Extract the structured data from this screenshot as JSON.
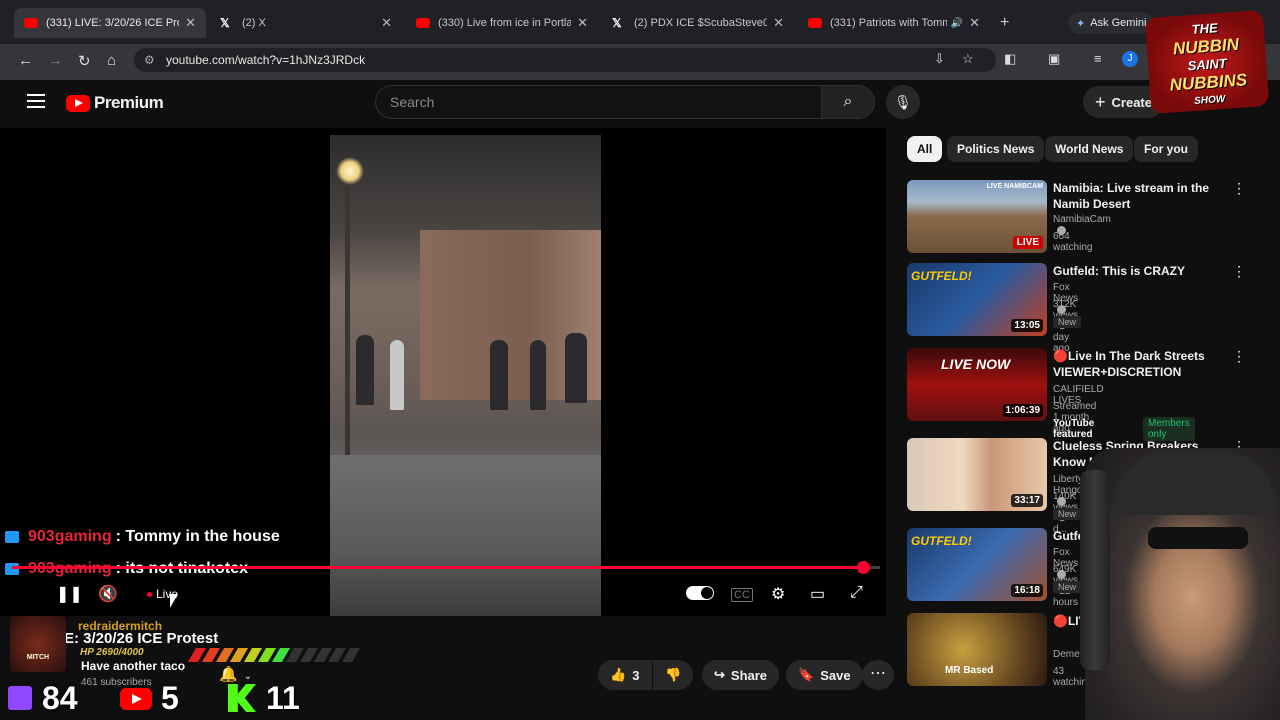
{
  "browser": {
    "tabs": [
      {
        "label": "(331) LIVE: 3/20/26 ICE Protest",
        "icon": "youtube-icon",
        "active": true
      },
      {
        "label": "(2) X",
        "icon": "x-icon",
        "active": false
      },
      {
        "label": "(330) Live from ice in Portland",
        "icon": "youtube-icon",
        "active": false
      },
      {
        "label": "(2) PDX ICE $ScubaSteve02626",
        "icon": "x-icon",
        "active": false
      },
      {
        "label": "(331) Patriots with Tommy",
        "icon": "youtube-icon",
        "active": false
      }
    ],
    "new_tab": "+",
    "gemini": "Ask Gemini",
    "url": "youtube.com/watch?v=1hJNz3JRDck",
    "profile_initial": "J"
  },
  "youtube": {
    "logo_text": "Premium",
    "search_placeholder": "Search",
    "create_label": "Create"
  },
  "player": {
    "live_label": "Live",
    "progress_fraction": 0.98
  },
  "chat_overlay": [
    {
      "user": "903gaming",
      "message": ": Tommy in the house"
    },
    {
      "user": "903gaming",
      "message": ": its not tinakotex"
    }
  ],
  "video_info": {
    "title_partial": "E: 3/20/26 ICE Protest",
    "subscribers": "461 subscribers",
    "like_count": "3",
    "share_label": "Share",
    "save_label": "Save"
  },
  "stream_overlay": {
    "username": "redraidermitch",
    "avatar_text": "MITCH",
    "hp": "HP 2690/4000",
    "message": "Have another taco",
    "twitch_count": "84",
    "youtube_count": "5",
    "kick_count": "11",
    "show_logo": [
      "THE",
      "NUBBIN",
      "SAINT",
      "NUBBINS",
      "SHOW"
    ]
  },
  "chips": [
    "All",
    "Politics News",
    "World News",
    "For you"
  ],
  "recommendations": [
    {
      "title": "Namibia: Live stream in the Namib Desert",
      "channel": "NamibiaCam",
      "meta": "664 watching",
      "badge": "LIVE",
      "badge_type": "live",
      "thumb_text": "LIVE NAMIBCAM"
    },
    {
      "title": "Gutfeld: This is CRAZY",
      "channel": "Fox News",
      "meta": "312K views • 1 day ago",
      "badge": "13:05",
      "badge_type": "duration",
      "new": "New",
      "thumb_text": "GUTFELD!"
    },
    {
      "title": "🔴Live In The Dark Streets VIEWER+DISCRETION",
      "channel": "CALIFIELD LIVES",
      "meta": "Streamed 1 month ago",
      "badge": "1:06:39",
      "badge_type": "duration",
      "featured": "YouTube featured",
      "members": "Members only",
      "thumb_text": "LIVE NOW"
    },
    {
      "title": "Clueless Spring Breakers Know NOTHING About America!",
      "channel": "Liberty Hangout",
      "meta": "140K views • 1 d...",
      "badge": "33:17",
      "badge_type": "duration",
      "new": "New",
      "thumb_text": ""
    },
    {
      "title": "Gutfeld: She is PiSs",
      "channel": "Fox News",
      "meta": "649K views • 22 hours",
      "badge": "16:18",
      "badge_type": "duration",
      "new": "New",
      "thumb_text": "GUTFELD!"
    },
    {
      "title": "🔴LIVE: MR B (3/20/2026)",
      "channel": "Demetrius",
      "meta": "43 watching",
      "badge": "",
      "badge_type": "none",
      "thumb_text": "MR Based"
    }
  ]
}
